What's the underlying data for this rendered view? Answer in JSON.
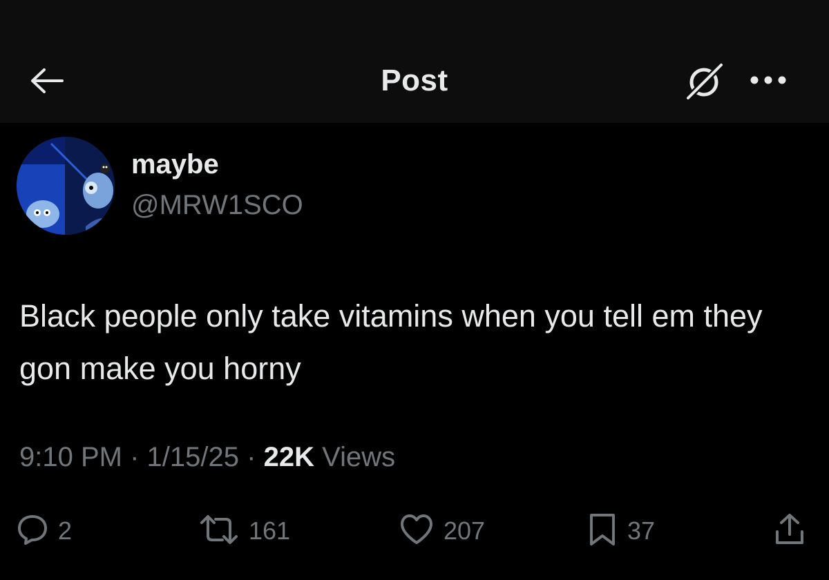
{
  "header": {
    "title": "Post",
    "back_icon": "arrow-left-icon",
    "grok_icon": "grok-icon",
    "more_icon": "more-horizontal-icon"
  },
  "author": {
    "name": "maybe",
    "handle": "@MRW1SCO"
  },
  "post": {
    "text": "Black people only take vitamins when you tell em they gon make you horny"
  },
  "meta": {
    "time": "9:10 PM",
    "separator": "·",
    "date": "1/15/25",
    "views_count": "22K",
    "views_label": "Views"
  },
  "actions": {
    "replies": "2",
    "reposts": "161",
    "likes": "207",
    "bookmarks": "37"
  },
  "colors": {
    "background": "#000000",
    "header_bg": "#0d0d0d",
    "primary_text": "#e7e9ea",
    "secondary_text": "#71767b"
  }
}
